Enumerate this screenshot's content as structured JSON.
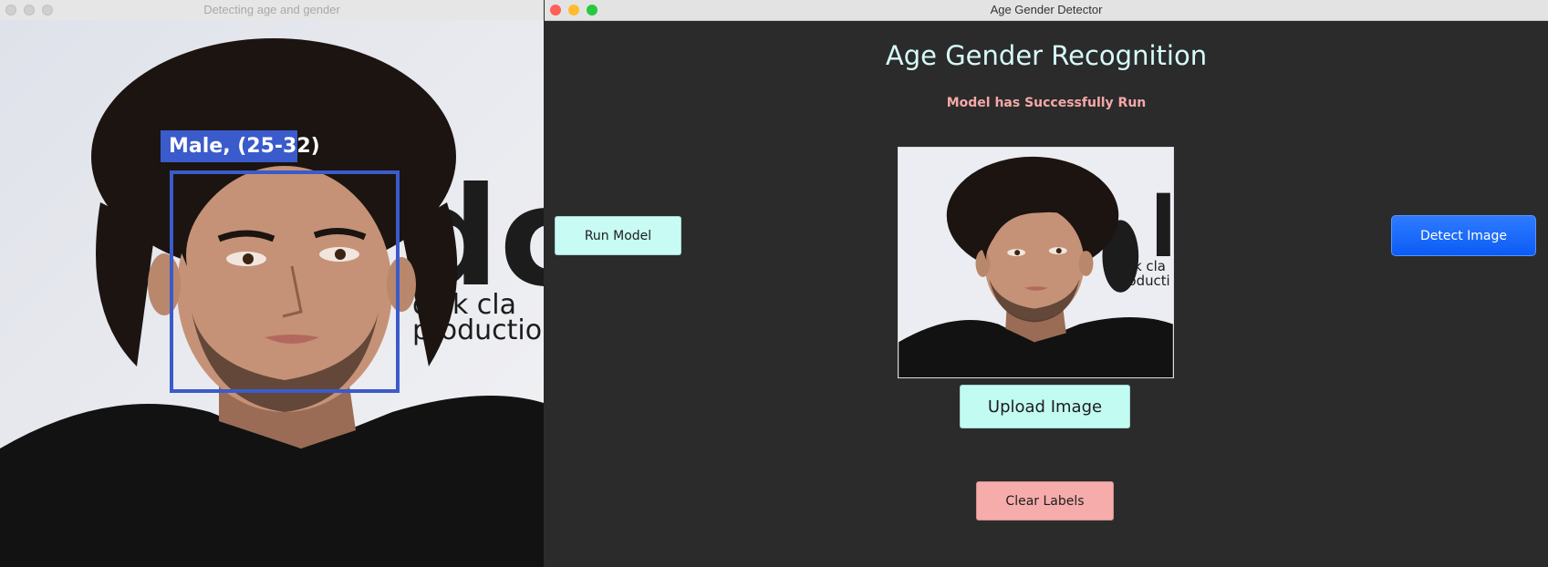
{
  "left_window": {
    "title": "Detecting age and gender",
    "detection_label": "Male, (25-32)",
    "watermark_big": "dc",
    "watermark_line1": "dick cla",
    "watermark_line2": "productio"
  },
  "right_window": {
    "title": "Age Gender Detector",
    "heading": "Age Gender Recognition",
    "status": "Model has Successfully Run",
    "buttons": {
      "run_model": "Run Model",
      "detect_image": "Detect Image",
      "upload_image": "Upload Image",
      "clear_labels": "Clear Labels"
    },
    "preview": {
      "watermark_line1": "dick cla",
      "watermark_line2": "producti"
    }
  },
  "colors": {
    "face_box": "#3a5bcb",
    "heading": "#d7fbfa",
    "status": "#f4a9a7",
    "run_button": "#c7fbf3",
    "upload_button": "#c2fbf2",
    "clear_button": "#f6acab",
    "detect_button": "#0b5cf6",
    "window_bg": "#2b2b2b"
  }
}
